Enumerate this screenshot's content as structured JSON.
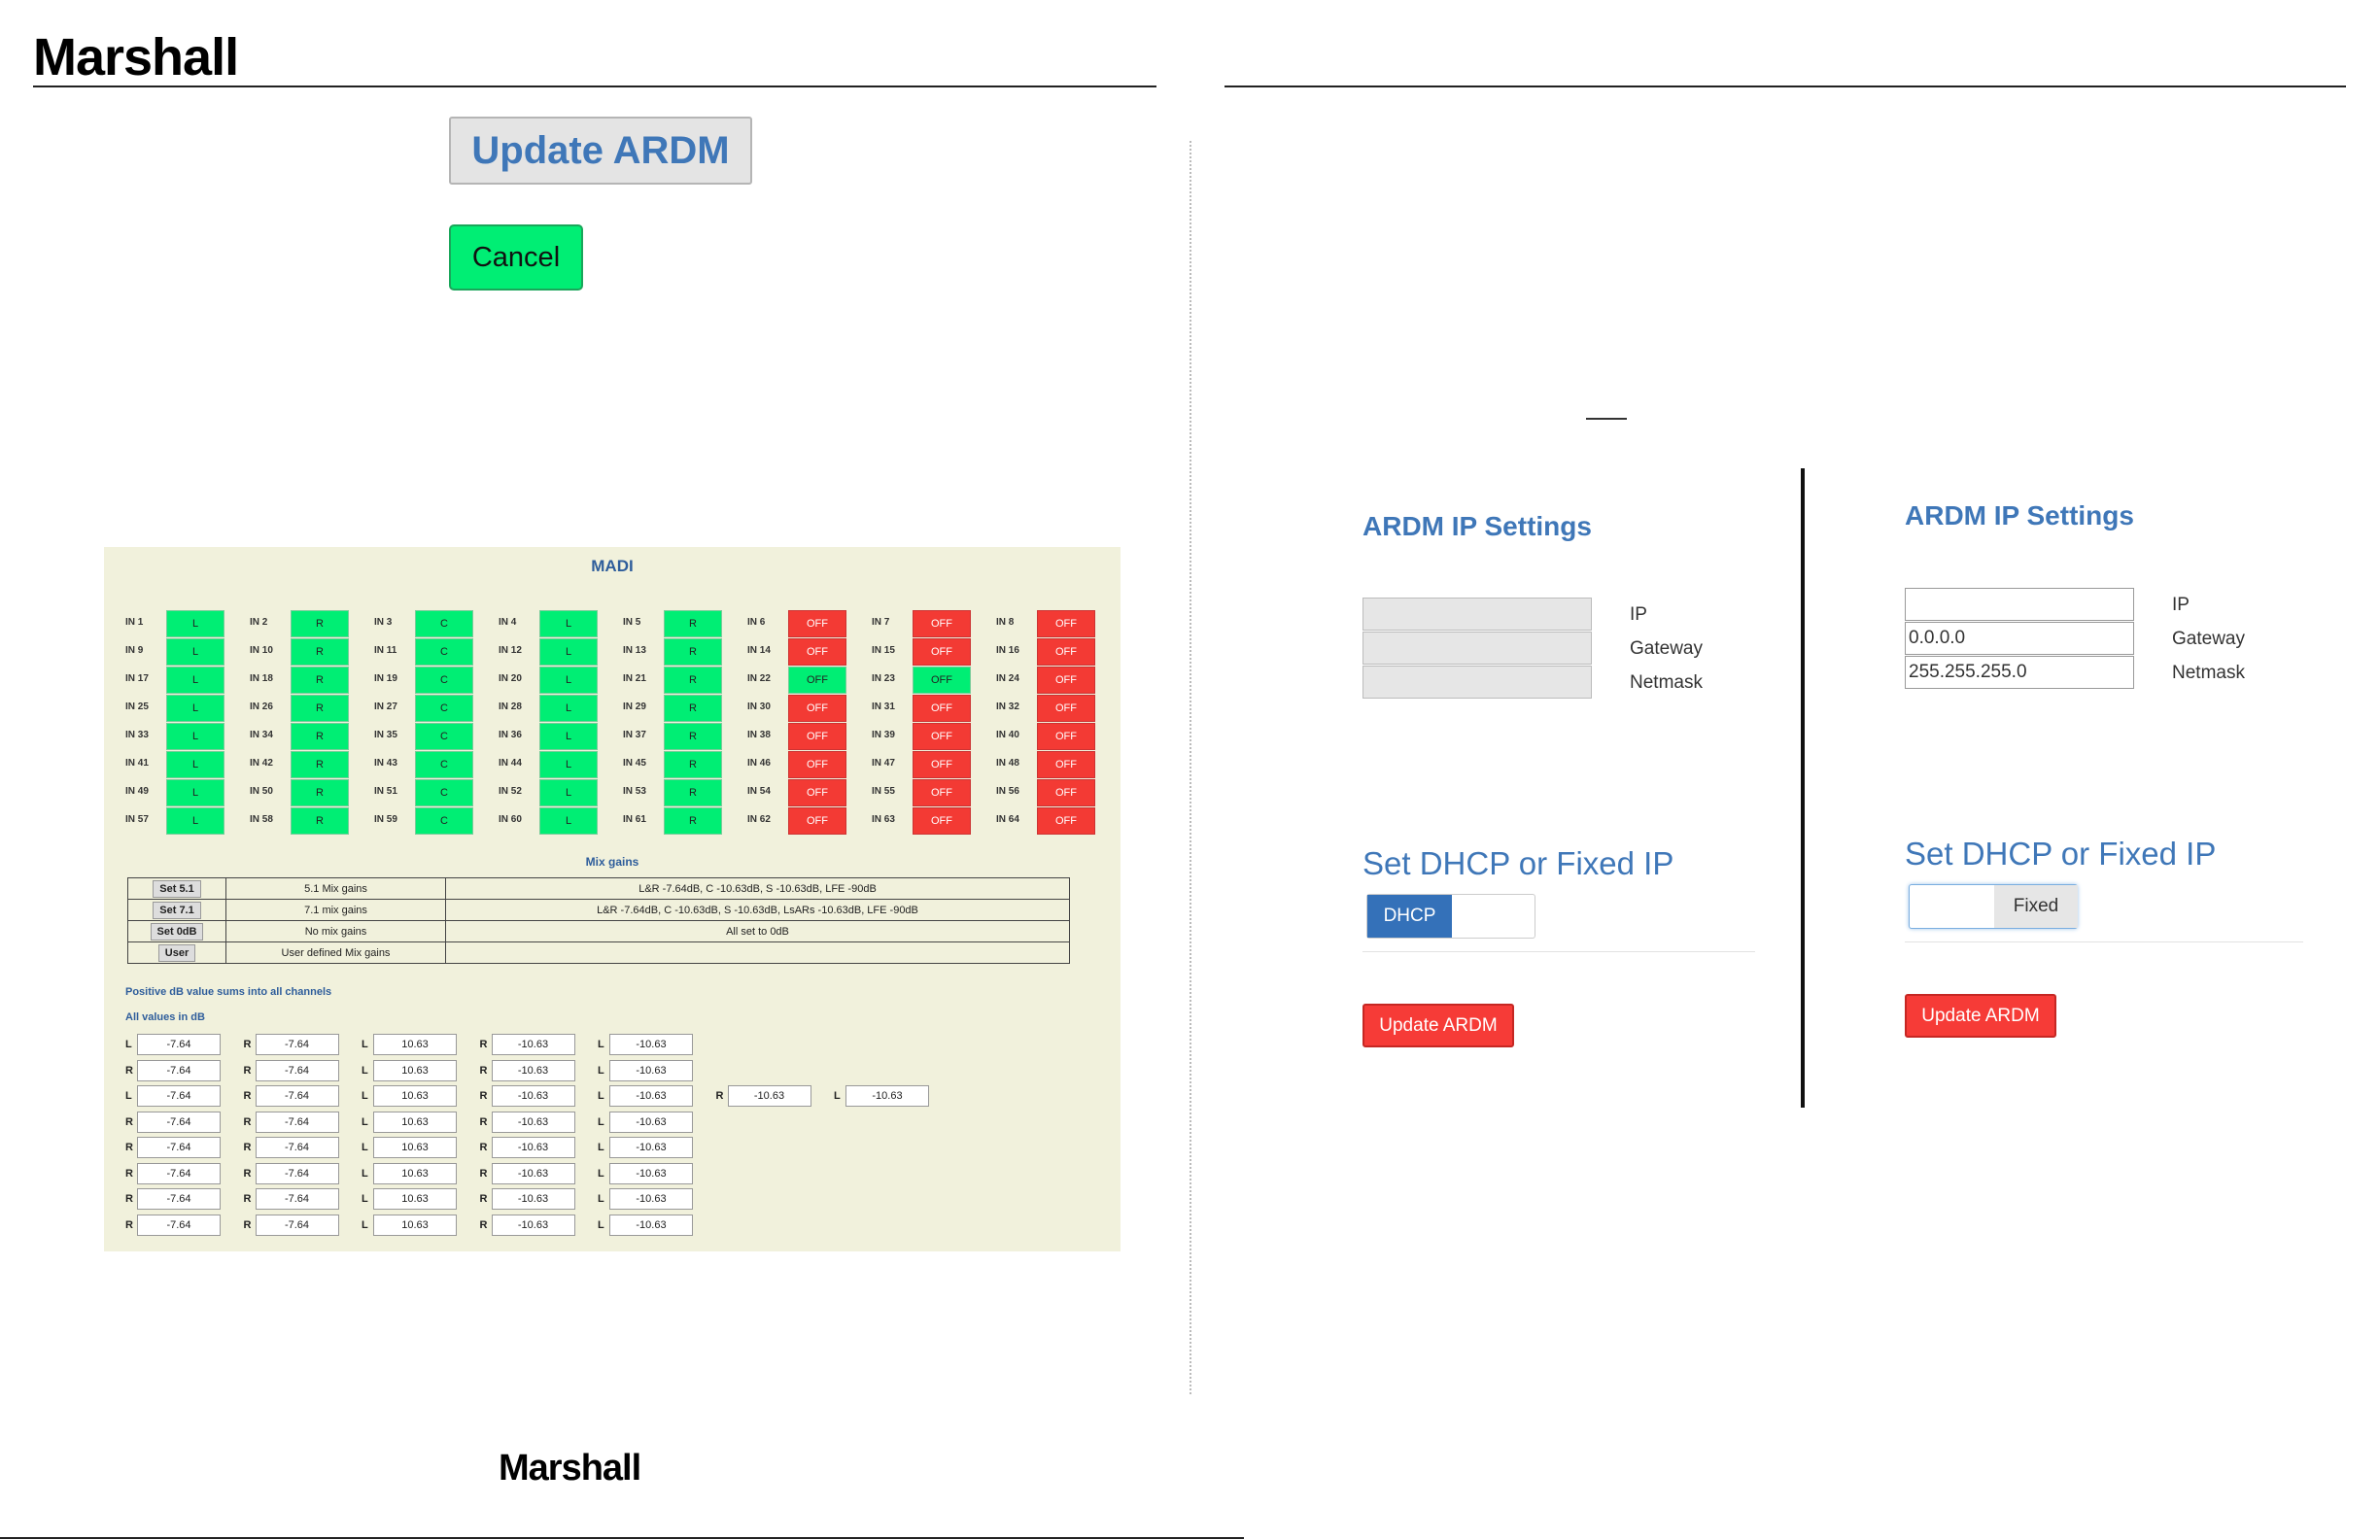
{
  "header": {
    "brand": "Marshall"
  },
  "footer": {
    "brand": "Marshall"
  },
  "dialog": {
    "update_label": "Update ARDM",
    "cancel_label": "Cancel"
  },
  "madi": {
    "title": "MADI",
    "channels": [
      [
        {
          "n": "IN 1",
          "v": "L"
        },
        {
          "n": "IN 2",
          "v": "R"
        },
        {
          "n": "IN 3",
          "v": "C"
        },
        {
          "n": "IN 4",
          "v": "L"
        },
        {
          "n": "IN 5",
          "v": "R"
        },
        {
          "n": "IN 6",
          "v": "OFF"
        },
        {
          "n": "IN 7",
          "v": "OFF"
        },
        {
          "n": "IN 8",
          "v": "OFF"
        }
      ],
      [
        {
          "n": "IN 9",
          "v": "L"
        },
        {
          "n": "IN 10",
          "v": "R"
        },
        {
          "n": "IN 11",
          "v": "C"
        },
        {
          "n": "IN 12",
          "v": "L"
        },
        {
          "n": "IN 13",
          "v": "R"
        },
        {
          "n": "IN 14",
          "v": "OFF"
        },
        {
          "n": "IN 15",
          "v": "OFF"
        },
        {
          "n": "IN 16",
          "v": "OFF"
        }
      ],
      [
        {
          "n": "IN 17",
          "v": "L"
        },
        {
          "n": "IN 18",
          "v": "R"
        },
        {
          "n": "IN 19",
          "v": "C"
        },
        {
          "n": "IN 20",
          "v": "L"
        },
        {
          "n": "IN 21",
          "v": "R"
        },
        {
          "n": "IN 22",
          "v": "OFF",
          "on": true
        },
        {
          "n": "IN 23",
          "v": "OFF",
          "on": true
        },
        {
          "n": "IN 24",
          "v": "OFF"
        }
      ],
      [
        {
          "n": "IN 25",
          "v": "L"
        },
        {
          "n": "IN 26",
          "v": "R"
        },
        {
          "n": "IN 27",
          "v": "C"
        },
        {
          "n": "IN 28",
          "v": "L"
        },
        {
          "n": "IN 29",
          "v": "R"
        },
        {
          "n": "IN 30",
          "v": "OFF"
        },
        {
          "n": "IN 31",
          "v": "OFF"
        },
        {
          "n": "IN 32",
          "v": "OFF"
        }
      ],
      [
        {
          "n": "IN 33",
          "v": "L"
        },
        {
          "n": "IN 34",
          "v": "R"
        },
        {
          "n": "IN 35",
          "v": "C"
        },
        {
          "n": "IN 36",
          "v": "L"
        },
        {
          "n": "IN 37",
          "v": "R"
        },
        {
          "n": "IN 38",
          "v": "OFF"
        },
        {
          "n": "IN 39",
          "v": "OFF"
        },
        {
          "n": "IN 40",
          "v": "OFF"
        }
      ],
      [
        {
          "n": "IN 41",
          "v": "L"
        },
        {
          "n": "IN 42",
          "v": "R"
        },
        {
          "n": "IN 43",
          "v": "C"
        },
        {
          "n": "IN 44",
          "v": "L"
        },
        {
          "n": "IN 45",
          "v": "R"
        },
        {
          "n": "IN 46",
          "v": "OFF"
        },
        {
          "n": "IN 47",
          "v": "OFF"
        },
        {
          "n": "IN 48",
          "v": "OFF"
        }
      ],
      [
        {
          "n": "IN 49",
          "v": "L"
        },
        {
          "n": "IN 50",
          "v": "R"
        },
        {
          "n": "IN 51",
          "v": "C"
        },
        {
          "n": "IN 52",
          "v": "L"
        },
        {
          "n": "IN 53",
          "v": "R"
        },
        {
          "n": "IN 54",
          "v": "OFF"
        },
        {
          "n": "IN 55",
          "v": "OFF"
        },
        {
          "n": "IN 56",
          "v": "OFF"
        }
      ],
      [
        {
          "n": "IN 57",
          "v": "L"
        },
        {
          "n": "IN 58",
          "v": "R"
        },
        {
          "n": "IN 59",
          "v": "C"
        },
        {
          "n": "IN 60",
          "v": "L"
        },
        {
          "n": "IN 61",
          "v": "R"
        },
        {
          "n": "IN 62",
          "v": "OFF"
        },
        {
          "n": "IN 63",
          "v": "OFF"
        },
        {
          "n": "IN 64",
          "v": "OFF"
        }
      ]
    ],
    "mix_title": "Mix gains",
    "mix_rows": [
      {
        "btn": "Set 5.1",
        "name": "5.1 Mix gains",
        "desc": "L&R -7.64dB, C -10.63dB, S -10.63dB, LFE -90dB"
      },
      {
        "btn": "Set 7.1",
        "name": "7.1 mix gains",
        "desc": "L&R -7.64dB, C -10.63dB, S -10.63dB, LsARs -10.63dB, LFE -90dB"
      },
      {
        "btn": "Set 0dB",
        "name": "No mix gains",
        "desc": "All set to 0dB"
      },
      {
        "btn": "User",
        "name": "User defined Mix gains",
        "desc": ""
      }
    ],
    "note1": "Positive dB value sums into all channels",
    "note2": "All values in dB",
    "gains": [
      [
        [
          "L",
          "-7.64"
        ],
        [
          "R",
          "-7.64"
        ],
        [
          "L",
          "10.63"
        ],
        [
          "R",
          "-10.63"
        ],
        [
          "L",
          "-10.63"
        ]
      ],
      [
        [
          "R",
          "-7.64"
        ],
        [
          "R",
          "-7.64"
        ],
        [
          "L",
          "10.63"
        ],
        [
          "R",
          "-10.63"
        ],
        [
          "L",
          "-10.63"
        ]
      ],
      [
        [
          "L",
          "-7.64"
        ],
        [
          "R",
          "-7.64"
        ],
        [
          "L",
          "10.63"
        ],
        [
          "R",
          "-10.63"
        ],
        [
          "L",
          "-10.63"
        ],
        [
          "R",
          "-10.63"
        ],
        [
          "L",
          "-10.63"
        ]
      ],
      [
        [
          "R",
          "-7.64"
        ],
        [
          "R",
          "-7.64"
        ],
        [
          "L",
          "10.63"
        ],
        [
          "R",
          "-10.63"
        ],
        [
          "L",
          "-10.63"
        ]
      ],
      [
        [
          "R",
          "-7.64"
        ],
        [
          "R",
          "-7.64"
        ],
        [
          "L",
          "10.63"
        ],
        [
          "R",
          "-10.63"
        ],
        [
          "L",
          "-10.63"
        ]
      ],
      [
        [
          "R",
          "-7.64"
        ],
        [
          "R",
          "-7.64"
        ],
        [
          "L",
          "10.63"
        ],
        [
          "R",
          "-10.63"
        ],
        [
          "L",
          "-10.63"
        ]
      ],
      [
        [
          "R",
          "-7.64"
        ],
        [
          "R",
          "-7.64"
        ],
        [
          "L",
          "10.63"
        ],
        [
          "R",
          "-10.63"
        ],
        [
          "L",
          "-10.63"
        ]
      ],
      [
        [
          "R",
          "-7.64"
        ],
        [
          "R",
          "-7.64"
        ],
        [
          "L",
          "10.63"
        ],
        [
          "R",
          "-10.63"
        ],
        [
          "L",
          "-10.63"
        ]
      ]
    ]
  },
  "ip_left": {
    "title": "ARDM IP Settings",
    "labels": [
      "IP",
      "Gateway",
      "Netmask"
    ],
    "values": [
      "",
      "",
      ""
    ],
    "mode_title": "Set DHCP or Fixed IP",
    "toggle_label": "DHCP",
    "update_label": "Update ARDM"
  },
  "ip_right": {
    "title": "ARDM IP Settings",
    "labels": [
      "IP",
      "Gateway",
      "Netmask"
    ],
    "values": [
      "",
      "0.0.0.0",
      "255.255.255.0"
    ],
    "mode_title": "Set DHCP or Fixed IP",
    "toggle_label": "Fixed",
    "update_label": "Update ARDM"
  },
  "colors": {
    "on": "#00ee74",
    "off": "#f33a34",
    "accent": "#3f77b8"
  }
}
